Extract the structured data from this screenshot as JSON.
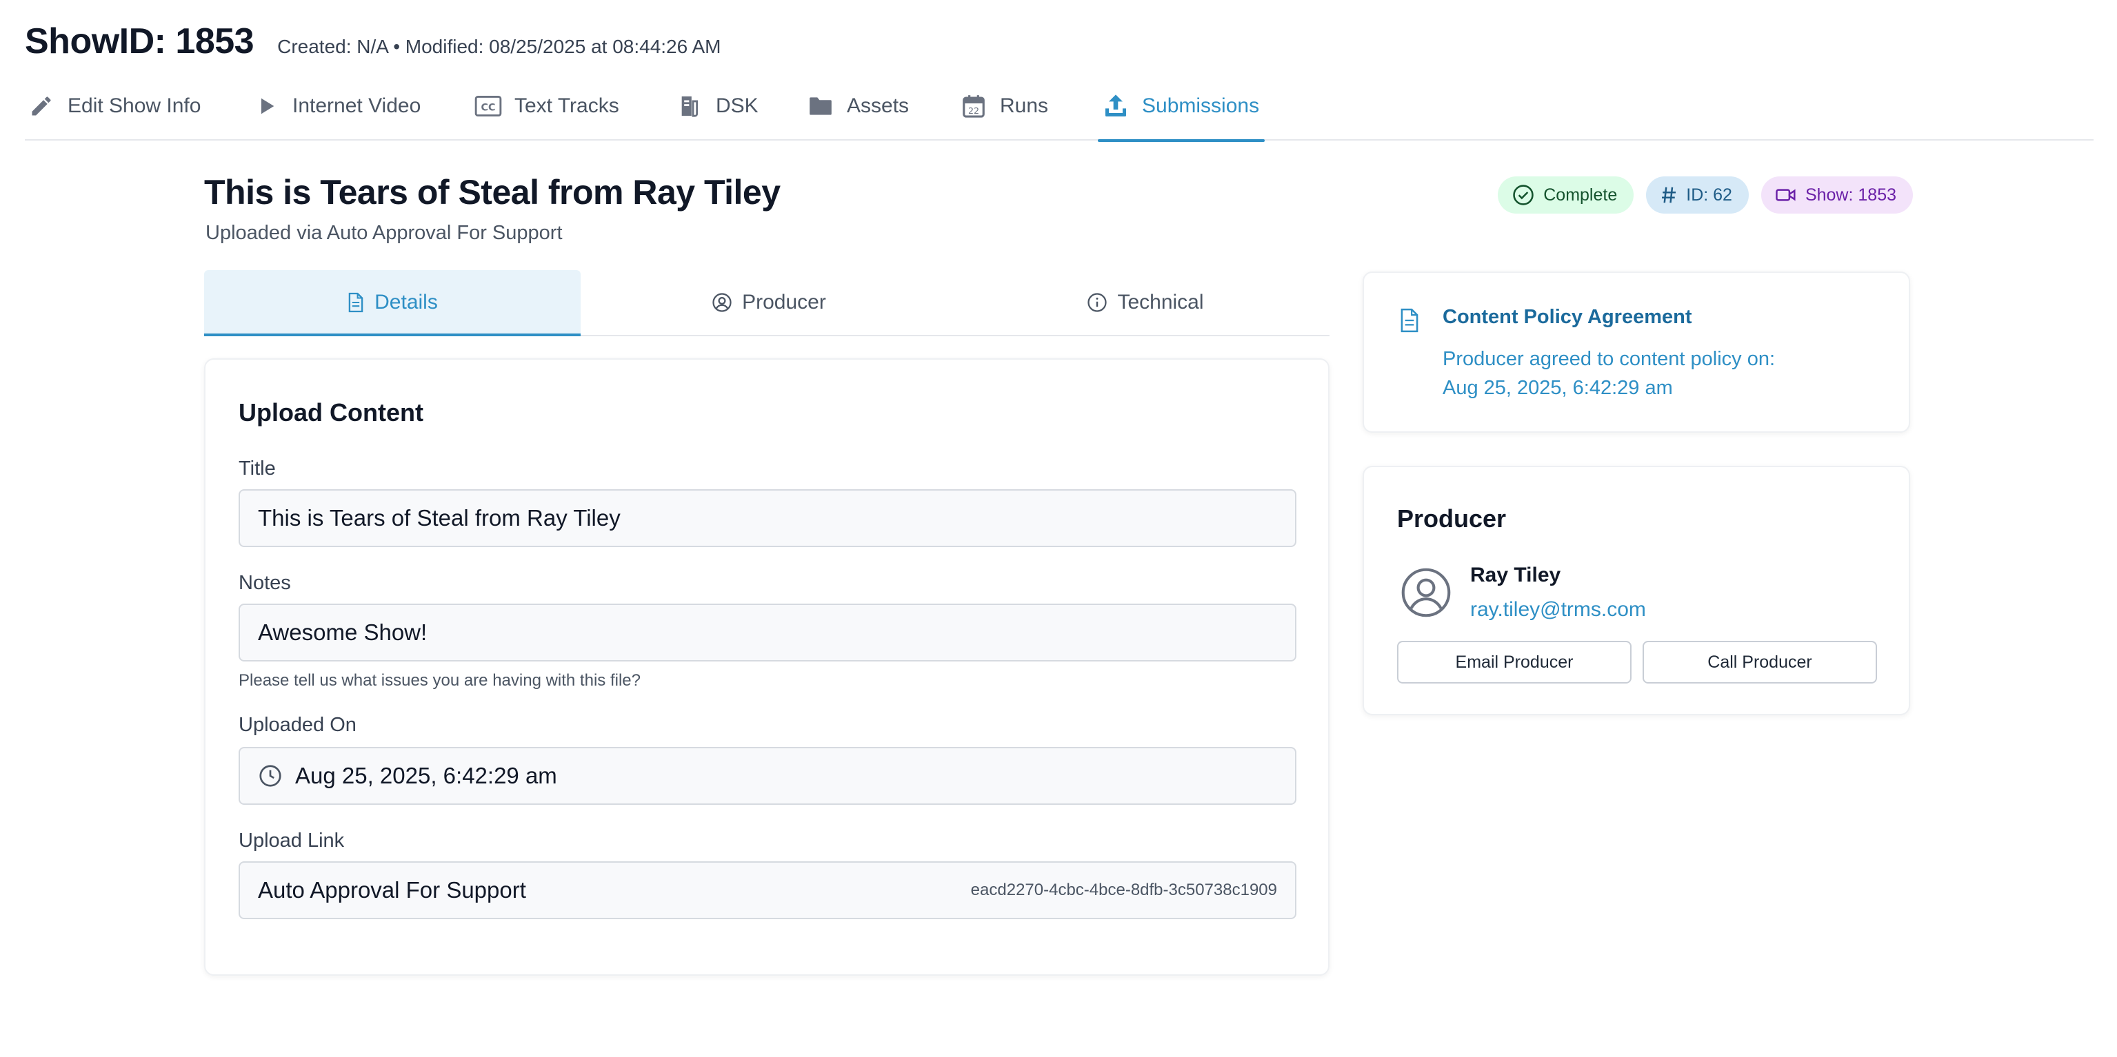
{
  "header": {
    "title": "ShowID: 1853",
    "meta": "Created: N/A • Modified: 08/25/2025 at 08:44:26 AM"
  },
  "nav": {
    "items": [
      {
        "label": "Edit Show Info",
        "icon": "pencil-icon"
      },
      {
        "label": "Internet Video",
        "icon": "play-icon"
      },
      {
        "label": "Text Tracks",
        "icon": "closed-captions-icon"
      },
      {
        "label": "DSK",
        "icon": "dsk-icon"
      },
      {
        "label": "Assets",
        "icon": "folder-icon"
      },
      {
        "label": "Runs",
        "icon": "calendar-icon"
      },
      {
        "label": "Submissions",
        "icon": "upload-icon",
        "active": true
      }
    ],
    "calendar_day": "22"
  },
  "submission": {
    "title": "This is Tears of Steal from Ray Tiley",
    "subtitle": "Uploaded via Auto Approval For Support",
    "badges": {
      "status": "Complete",
      "id": "ID: 62",
      "show": "Show: 1853"
    }
  },
  "tabs": [
    {
      "label": "Details",
      "icon": "document-icon",
      "active": true
    },
    {
      "label": "Producer",
      "icon": "user-circle-icon"
    },
    {
      "label": "Technical",
      "icon": "info-icon"
    }
  ],
  "upload": {
    "heading": "Upload Content",
    "title_label": "Title",
    "title_value": "This is Tears of Steal from Ray Tiley",
    "notes_label": "Notes",
    "notes_value": "Awesome Show!",
    "notes_help": "Please tell us what issues you are having with this file?",
    "uploaded_on_label": "Uploaded On",
    "uploaded_on_value": "Aug 25, 2025, 6:42:29 am",
    "upload_link_label": "Upload Link",
    "upload_link_value": "Auto Approval For Support",
    "upload_link_id": "eacd2270-4cbc-4bce-8dfb-3c50738c1909"
  },
  "policy": {
    "title": "Content Policy Agreement",
    "line1": "Producer agreed to content policy on:",
    "line2": "Aug 25, 2025, 6:42:29 am"
  },
  "producer": {
    "heading": "Producer",
    "name": "Ray Tiley",
    "email": "ray.tiley@trms.com",
    "email_button": "Email Producer",
    "call_button": "Call Producer"
  },
  "colors": {
    "accent": "#2e8fc5",
    "complete_bg": "#dcfce7",
    "id_bg": "#d6e9f7",
    "show_bg": "#f3e3fa"
  }
}
